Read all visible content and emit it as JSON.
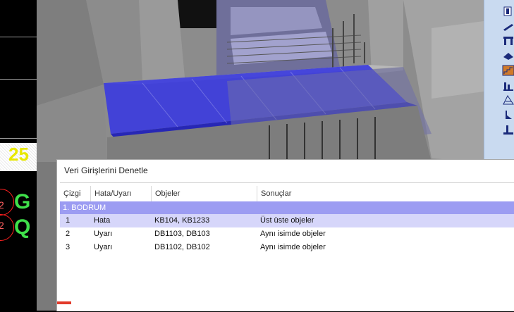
{
  "cad": {
    "hatch_number": "25",
    "circle_a_label": "2",
    "circle_b_label": "2",
    "letter_a": "G",
    "letter_b": "Q"
  },
  "dialog": {
    "title": "Veri Girişlerini Denetle",
    "columns": [
      "Çizgi",
      "Hata/Uyarı",
      "Objeler",
      "Sonuçlar"
    ],
    "group": "1. BODRUM",
    "rows": [
      {
        "line": "1",
        "type": "Hata",
        "objects": "KB104, KB1233",
        "result": "Üst üste objeler"
      },
      {
        "line": "2",
        "type": "Uyarı",
        "objects": "DB1103, DB103",
        "result": "Aynı isimde objeler"
      },
      {
        "line": "3",
        "type": "Uyarı",
        "objects": "DB1102, DB102",
        "result": "Aynı isimde objeler"
      }
    ]
  },
  "colors": {
    "selection": "#d6d6fa",
    "group_header": "#9c9cf2",
    "slab": "#3030e0",
    "toolbar": "#c9daf0"
  },
  "toolbar": {
    "icons": [
      "column-icon",
      "beam-icon",
      "wall-icon",
      "slab-icon",
      "stair-icon",
      "footing-icon",
      "dimension-icon",
      "axis-icon",
      "support-icon"
    ]
  }
}
